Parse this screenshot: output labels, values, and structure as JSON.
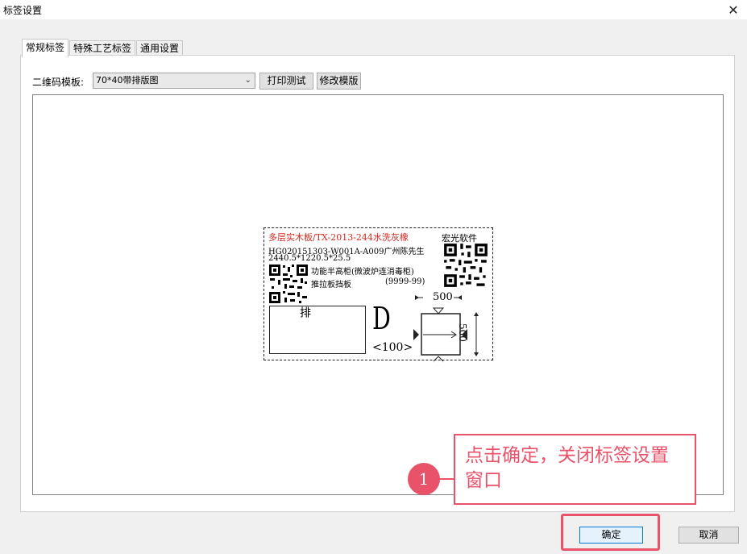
{
  "window": {
    "title": "标签设置",
    "close_glyph": "✕"
  },
  "tabs": [
    {
      "label": "常规标签",
      "active": true
    },
    {
      "label": "特殊工艺标签",
      "active": false
    },
    {
      "label": "通用设置",
      "active": false
    }
  ],
  "template": {
    "label": "二维码模板:",
    "selected": "70*40带排版图",
    "print_test": "打印测试",
    "edit_template": "修改模版"
  },
  "label_preview": {
    "title_line": "多层实木板/TX-2013-244水洗灰橡",
    "brand": "宏光软件",
    "order_line": "HG02015130З-W001A-A009广州陈先生",
    "size_line": "2440.5*1220.5*25.5",
    "part_line": "功能半高柜(微波炉连消毒柜)",
    "part_name": "推拉板挡板",
    "code": "(9999-99)",
    "layout_mark": "排",
    "edge_letter": "D",
    "edge_value": "<100>",
    "dim_top": "500",
    "dim_right": "500"
  },
  "callout": {
    "number": "1",
    "text": "点击确定，关闭标签设置窗口"
  },
  "buttons": {
    "ok": "确定",
    "cancel": "取消"
  },
  "colors": {
    "callout": "#e8536a",
    "label_red": "#d4271e"
  }
}
